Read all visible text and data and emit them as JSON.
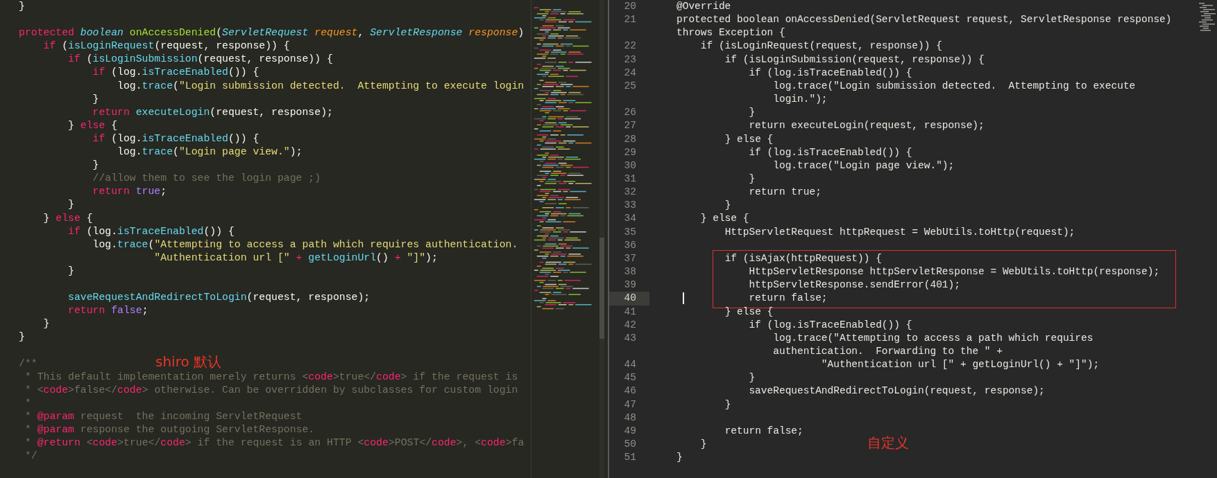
{
  "left_editor": {
    "annotation": "shiro 默认",
    "lines": [
      {
        "kind": "code",
        "tokens": [
          {
            "text": "}",
            "kind": "plain"
          }
        ]
      },
      {
        "kind": "blank"
      },
      {
        "kind": "code",
        "tokens": [
          {
            "text": "protected ",
            "kind": "keyword"
          },
          {
            "text": "boolean ",
            "kind": "type"
          },
          {
            "text": "onAccessDenied",
            "kind": "definition"
          },
          {
            "text": "(",
            "kind": "plain"
          },
          {
            "text": "ServletRequest ",
            "kind": "type"
          },
          {
            "text": "request",
            "kind": "param"
          },
          {
            "text": ", ",
            "kind": "plain"
          },
          {
            "text": "ServletResponse ",
            "kind": "type"
          },
          {
            "text": "response",
            "kind": "param"
          },
          {
            "text": ")",
            "kind": "plain"
          }
        ]
      },
      {
        "kind": "code",
        "tokens": [
          {
            "text": "    if",
            "kind": "keyword"
          },
          {
            "text": " (",
            "kind": "plain"
          },
          {
            "text": "isLoginRequest",
            "kind": "function"
          },
          {
            "text": "(request, response)) {",
            "kind": "plain"
          }
        ]
      },
      {
        "kind": "code",
        "tokens": [
          {
            "text": "        if",
            "kind": "keyword"
          },
          {
            "text": " (",
            "kind": "plain"
          },
          {
            "text": "isLoginSubmission",
            "kind": "function"
          },
          {
            "text": "(request, response)) {",
            "kind": "plain"
          }
        ]
      },
      {
        "kind": "code",
        "tokens": [
          {
            "text": "            if",
            "kind": "keyword"
          },
          {
            "text": " (log.",
            "kind": "plain"
          },
          {
            "text": "isTraceEnabled",
            "kind": "function"
          },
          {
            "text": "()) {",
            "kind": "plain"
          }
        ]
      },
      {
        "kind": "code",
        "tokens": [
          {
            "text": "                log.",
            "kind": "plain"
          },
          {
            "text": "trace",
            "kind": "function"
          },
          {
            "text": "(",
            "kind": "plain"
          },
          {
            "text": "\"Login submission detected.  Attempting to execute login",
            "kind": "string"
          }
        ]
      },
      {
        "kind": "code",
        "tokens": [
          {
            "text": "            }",
            "kind": "plain"
          }
        ]
      },
      {
        "kind": "code",
        "tokens": [
          {
            "text": "            return ",
            "kind": "keyword"
          },
          {
            "text": "executeLogin",
            "kind": "function"
          },
          {
            "text": "(request, response);",
            "kind": "plain"
          }
        ]
      },
      {
        "kind": "code",
        "tokens": [
          {
            "text": "        } ",
            "kind": "plain"
          },
          {
            "text": "else",
            "kind": "keyword"
          },
          {
            "text": " {",
            "kind": "plain"
          }
        ]
      },
      {
        "kind": "code",
        "tokens": [
          {
            "text": "            if",
            "kind": "keyword"
          },
          {
            "text": " (log.",
            "kind": "plain"
          },
          {
            "text": "isTraceEnabled",
            "kind": "function"
          },
          {
            "text": "()) {",
            "kind": "plain"
          }
        ]
      },
      {
        "kind": "code",
        "tokens": [
          {
            "text": "                log.",
            "kind": "plain"
          },
          {
            "text": "trace",
            "kind": "function"
          },
          {
            "text": "(",
            "kind": "plain"
          },
          {
            "text": "\"Login page view.\"",
            "kind": "string"
          },
          {
            "text": ");",
            "kind": "plain"
          }
        ]
      },
      {
        "kind": "code",
        "tokens": [
          {
            "text": "            }",
            "kind": "plain"
          }
        ]
      },
      {
        "kind": "code",
        "tokens": [
          {
            "text": "            //allow them to see the login page ;)",
            "kind": "comment"
          }
        ]
      },
      {
        "kind": "code",
        "tokens": [
          {
            "text": "            return ",
            "kind": "keyword"
          },
          {
            "text": "true",
            "kind": "constant"
          },
          {
            "text": ";",
            "kind": "plain"
          }
        ]
      },
      {
        "kind": "code",
        "tokens": [
          {
            "text": "        }",
            "kind": "plain"
          }
        ]
      },
      {
        "kind": "code",
        "tokens": [
          {
            "text": "    } ",
            "kind": "plain"
          },
          {
            "text": "else",
            "kind": "keyword"
          },
          {
            "text": " {",
            "kind": "plain"
          }
        ]
      },
      {
        "kind": "code",
        "tokens": [
          {
            "text": "        if",
            "kind": "keyword"
          },
          {
            "text": " (log.",
            "kind": "plain"
          },
          {
            "text": "isTraceEnabled",
            "kind": "function"
          },
          {
            "text": "()) {",
            "kind": "plain"
          }
        ]
      },
      {
        "kind": "code",
        "tokens": [
          {
            "text": "            log.",
            "kind": "plain"
          },
          {
            "text": "trace",
            "kind": "function"
          },
          {
            "text": "(",
            "kind": "plain"
          },
          {
            "text": "\"Attempting to access a path which requires authentication.",
            "kind": "string"
          }
        ]
      },
      {
        "kind": "code",
        "tokens": [
          {
            "text": "                      \"Authentication url [\"",
            "kind": "string"
          },
          {
            "text": " + ",
            "kind": "operator"
          },
          {
            "text": "getLoginUrl",
            "kind": "function"
          },
          {
            "text": "()",
            "kind": "plain"
          },
          {
            "text": " + ",
            "kind": "operator"
          },
          {
            "text": "\"]\"",
            "kind": "string"
          },
          {
            "text": ");",
            "kind": "plain"
          }
        ]
      },
      {
        "kind": "code",
        "tokens": [
          {
            "text": "        }",
            "kind": "plain"
          }
        ]
      },
      {
        "kind": "blank"
      },
      {
        "kind": "code",
        "tokens": [
          {
            "text": "        saveRequestAndRedirectToLogin",
            "kind": "function"
          },
          {
            "text": "(request, response);",
            "kind": "plain"
          }
        ]
      },
      {
        "kind": "code",
        "tokens": [
          {
            "text": "        return ",
            "kind": "keyword"
          },
          {
            "text": "false",
            "kind": "constant"
          },
          {
            "text": ";",
            "kind": "plain"
          }
        ]
      },
      {
        "kind": "code",
        "tokens": [
          {
            "text": "    }",
            "kind": "plain"
          }
        ]
      },
      {
        "kind": "code",
        "tokens": [
          {
            "text": "}",
            "kind": "plain"
          }
        ]
      },
      {
        "kind": "blank"
      },
      {
        "kind": "code",
        "tokens": [
          {
            "text": "/**",
            "kind": "comment"
          }
        ]
      },
      {
        "kind": "code",
        "tokens": [
          {
            "text": " * This default implementation merely returns <",
            "kind": "comment"
          },
          {
            "text": "code",
            "kind": "tag"
          },
          {
            "text": ">true</",
            "kind": "comment"
          },
          {
            "text": "code",
            "kind": "tag"
          },
          {
            "text": "> if the request is",
            "kind": "comment"
          }
        ]
      },
      {
        "kind": "code",
        "tokens": [
          {
            "text": " * <",
            "kind": "comment"
          },
          {
            "text": "code",
            "kind": "tag"
          },
          {
            "text": ">false</",
            "kind": "comment"
          },
          {
            "text": "code",
            "kind": "tag"
          },
          {
            "text": "> otherwise. Can be overridden by subclasses for custom login",
            "kind": "comment"
          }
        ]
      },
      {
        "kind": "code",
        "tokens": [
          {
            "text": " *",
            "kind": "comment"
          }
        ]
      },
      {
        "kind": "code",
        "tokens": [
          {
            "text": " * ",
            "kind": "comment"
          },
          {
            "text": "@param",
            "kind": "tag"
          },
          {
            "text": " request  the incoming ServletRequest",
            "kind": "comment"
          }
        ]
      },
      {
        "kind": "code",
        "tokens": [
          {
            "text": " * ",
            "kind": "comment"
          },
          {
            "text": "@param",
            "kind": "tag"
          },
          {
            "text": " response the outgoing ServletResponse.",
            "kind": "comment"
          }
        ]
      },
      {
        "kind": "code",
        "tokens": [
          {
            "text": " * ",
            "kind": "comment"
          },
          {
            "text": "@return",
            "kind": "tag"
          },
          {
            "text": " <",
            "kind": "comment"
          },
          {
            "text": "code",
            "kind": "tag"
          },
          {
            "text": ">true</",
            "kind": "comment"
          },
          {
            "text": "code",
            "kind": "tag"
          },
          {
            "text": "> if the request is an HTTP <",
            "kind": "comment"
          },
          {
            "text": "code",
            "kind": "tag"
          },
          {
            "text": ">POST</",
            "kind": "comment"
          },
          {
            "text": "code",
            "kind": "tag"
          },
          {
            "text": ">, <",
            "kind": "comment"
          },
          {
            "text": "code",
            "kind": "tag"
          },
          {
            "text": ">fa",
            "kind": "comment"
          }
        ]
      },
      {
        "kind": "code",
        "tokens": [
          {
            "text": " */",
            "kind": "comment"
          }
        ]
      }
    ]
  },
  "right_editor": {
    "annotation": "自定义",
    "lines": [
      {
        "number": "20",
        "rows": [
          "@Override"
        ],
        "current": false,
        "boxed": false
      },
      {
        "number": "21",
        "rows": [
          "protected boolean onAccessDenied(ServletRequest request, ServletResponse response)",
          "throws Exception {"
        ],
        "current": false,
        "boxed": false
      },
      {
        "number": "22",
        "rows": [
          "    if (isLoginRequest(request, response)) {"
        ],
        "current": false,
        "boxed": false
      },
      {
        "number": "23",
        "rows": [
          "        if (isLoginSubmission(request, response)) {"
        ],
        "current": false,
        "boxed": false
      },
      {
        "number": "24",
        "rows": [
          "            if (log.isTraceEnabled()) {"
        ],
        "current": false,
        "boxed": false
      },
      {
        "number": "25",
        "rows": [
          "                log.trace(\"Login submission detected.  Attempting to execute",
          "                login.\");"
        ],
        "current": false,
        "boxed": false
      },
      {
        "number": "26",
        "rows": [
          "            }"
        ],
        "current": false,
        "boxed": false
      },
      {
        "number": "27",
        "rows": [
          "            return executeLogin(request, response);"
        ],
        "current": false,
        "boxed": false
      },
      {
        "number": "28",
        "rows": [
          "        } else {"
        ],
        "current": false,
        "boxed": false
      },
      {
        "number": "29",
        "rows": [
          "            if (log.isTraceEnabled()) {"
        ],
        "current": false,
        "boxed": false
      },
      {
        "number": "30",
        "rows": [
          "                log.trace(\"Login page view.\");"
        ],
        "current": false,
        "boxed": false
      },
      {
        "number": "31",
        "rows": [
          "            }"
        ],
        "current": false,
        "boxed": false
      },
      {
        "number": "32",
        "rows": [
          "            return true;"
        ],
        "current": false,
        "boxed": false
      },
      {
        "number": "33",
        "rows": [
          "        }"
        ],
        "current": false,
        "boxed": false
      },
      {
        "number": "34",
        "rows": [
          "    } else {"
        ],
        "current": false,
        "boxed": false
      },
      {
        "number": "35",
        "rows": [
          "        HttpServletRequest httpRequest = WebUtils.toHttp(request);"
        ],
        "current": false,
        "boxed": false
      },
      {
        "number": "36",
        "current": false,
        "boxed": false
      },
      {
        "number": "37",
        "rows": [
          "        if (isAjax(httpRequest)) {"
        ],
        "current": false,
        "boxed": true
      },
      {
        "number": "38",
        "rows": [
          "            HttpServletResponse httpServletResponse = WebUtils.toHttp(response);"
        ],
        "current": false,
        "boxed": true
      },
      {
        "number": "39",
        "rows": [
          "            httpServletResponse.sendError(401);"
        ],
        "current": false,
        "boxed": true
      },
      {
        "number": "40",
        "rows": [
          "            return false;"
        ],
        "current": true,
        "boxed": true
      },
      {
        "number": "41",
        "rows": [
          "        } else {"
        ],
        "current": false,
        "boxed": false
      },
      {
        "number": "42",
        "rows": [
          "            if (log.isTraceEnabled()) {"
        ],
        "current": false,
        "boxed": false
      },
      {
        "number": "43",
        "rows": [
          "                log.trace(\"Attempting to access a path which requires",
          "                authentication.  Forwarding to the \" +"
        ],
        "current": false,
        "boxed": false
      },
      {
        "number": "44",
        "rows": [
          "                        \"Authentication url [\" + getLoginUrl() + \"]\");"
        ],
        "current": false,
        "boxed": false
      },
      {
        "number": "45",
        "rows": [
          "            }"
        ],
        "current": false,
        "boxed": false
      },
      {
        "number": "46",
        "rows": [
          "            saveRequestAndRedirectToLogin(request, response);"
        ],
        "current": false,
        "boxed": false
      },
      {
        "number": "47",
        "rows": [
          "        }"
        ],
        "current": false,
        "boxed": false
      },
      {
        "number": "48",
        "current": false,
        "boxed": false
      },
      {
        "number": "49",
        "rows": [
          "        return false;"
        ],
        "current": false,
        "boxed": false
      },
      {
        "number": "50",
        "rows": [
          "    }"
        ],
        "current": false,
        "boxed": false
      },
      {
        "number": "51",
        "rows": [
          "}"
        ],
        "current": false,
        "boxed": false
      }
    ]
  }
}
